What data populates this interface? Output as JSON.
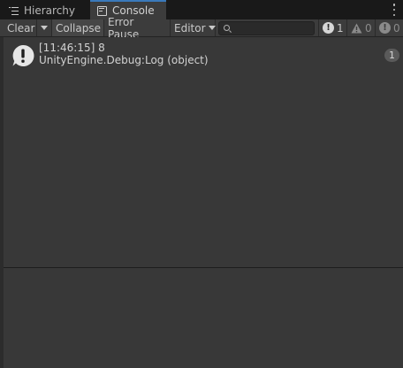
{
  "tabs": [
    {
      "label": "Hierarchy",
      "icon": "list-icon",
      "active": false
    },
    {
      "label": "Console",
      "icon": "console-icon",
      "active": true
    }
  ],
  "toolbar": {
    "clear_label": "Clear",
    "collapse_label": "Collapse",
    "error_pause_label": "Error Pause",
    "editor_label": "Editor",
    "search": {
      "value": "",
      "placeholder": ""
    },
    "error_count": "1",
    "warning_count": "0",
    "info_count": "0"
  },
  "log": {
    "entries": [
      {
        "icon": "info-icon",
        "line1": "[11:46:15] 8",
        "line2": "UnityEngine.Debug:Log (object)",
        "count": "1"
      }
    ]
  },
  "colors": {
    "background": "#282828",
    "tab_active": "#3c3c3c",
    "tab_accent": "#3a79bb",
    "log_background": "#383838"
  }
}
